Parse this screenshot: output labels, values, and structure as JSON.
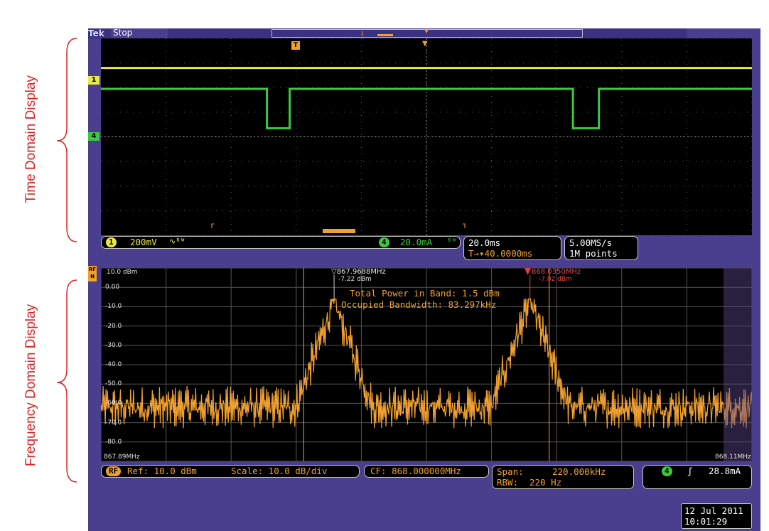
{
  "labels": {
    "time_domain": "Time Domain Display",
    "frequency_domain": "Frequency Domain Display"
  },
  "scope": {
    "logo": "Tek",
    "acq_state": "Stop",
    "trigger_marker": "T"
  },
  "time_domain": {
    "ch1_marker": "1",
    "ch4_marker": "4",
    "ch1_scale": "200mV",
    "ch1_coupling_icon": "∿ᴮᵂ",
    "ch4_scale": "20.0mA",
    "ch4_bw_icon": "ᴮᵂ",
    "horizontal_scale": "20.0ms",
    "horizontal_position": "T→▾40.0000ms",
    "sample_rate": "5.00MS/s",
    "record_length": "1M points"
  },
  "freq_domain": {
    "rf_marker": "RF N",
    "top_label": "10.0 dBm",
    "y_labels": [
      "0.00",
      "-10.0",
      "-20.0",
      "-30.0",
      "-40.0",
      "-50.0",
      "-60.0",
      "-70.0",
      "-80.0"
    ],
    "start_freq": "867.89MHz",
    "stop_freq": "868.11MHz",
    "marker1_freq": "▽867.9688MHz",
    "marker1_level": "-7.22 dBm",
    "marker2_freq": "868.0350MHz",
    "marker2_level": "-7.02 dBm",
    "measure_line1": "Total Power in Band: 1.5 dBm",
    "measure_line2": "Occupied Bandwidth: 83.297kHz",
    "rf_badge": "RF",
    "ref": "Ref: 10.0 dBm",
    "scale": "Scale: 10.0 dB/div",
    "cf": "CF: 868.000000MHz",
    "span_label": "Span:",
    "span_value": "220.000kHz",
    "rbw_label": "RBW:",
    "rbw_value": "220 Hz",
    "trig_ch": "4",
    "trig_slope": "ʃ",
    "trig_level": "28.8mA",
    "date": "12 Jul  2011",
    "time": "10:01:29"
  },
  "colors": {
    "ch1": "#e8e84a",
    "ch4": "#3ec83e",
    "spectrum": "#f0a030",
    "frame": "#4a3f8f",
    "label_red": "#e02020"
  },
  "chart_data": [
    {
      "type": "line",
      "name": "time_domain",
      "x_unit": "div",
      "xlim": [
        0,
        10
      ],
      "ylim": [
        -4,
        4
      ],
      "series": [
        {
          "x": [
            0,
            10
          ],
          "y": [
            2.8,
            2.8
          ]
        },
        {
          "x": [
            0,
            2.55,
            2.55,
            2.9,
            2.9,
            7.25,
            7.25,
            7.65,
            7.65,
            10
          ],
          "y": [
            1.95,
            1.95,
            0.35,
            0.35,
            1.95,
            1.95,
            0.35,
            0.35,
            1.95,
            1.95
          ]
        }
      ]
    },
    {
      "type": "line",
      "name": "spectrum",
      "x_unit": "MHz",
      "y_unit": "dBm",
      "xlim": [
        867.89,
        868.11
      ],
      "ylim": [
        -90,
        10
      ],
      "peaks": [
        {
          "freq": 867.9688,
          "level": -7.22
        },
        {
          "freq": 868.035,
          "level": -7.02
        }
      ],
      "noise_floor": -62
    }
  ]
}
